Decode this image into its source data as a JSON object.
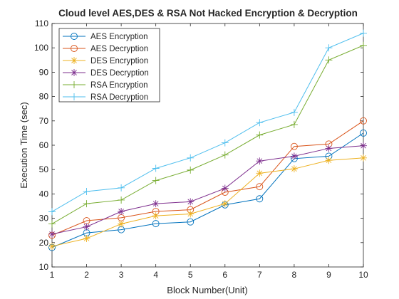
{
  "chart_data": {
    "type": "line",
    "title": "Cloud level AES,DES & RSA Not Hacked Encryption & Decryption",
    "xlabel": "Block Number(Unit)",
    "ylabel": "Execution Time (sec)",
    "xlim": [
      1,
      10
    ],
    "ylim": [
      10,
      110
    ],
    "xticks": [
      "1",
      "2",
      "3",
      "4",
      "5",
      "6",
      "7",
      "8",
      "9",
      "10"
    ],
    "yticks": [
      "10",
      "20",
      "30",
      "40",
      "50",
      "60",
      "70",
      "80",
      "90",
      "100",
      "110"
    ],
    "legend_position": "top-left",
    "x": [
      1,
      2,
      3,
      4,
      5,
      6,
      7,
      8,
      9,
      10
    ],
    "series": [
      {
        "name": "AES Encryption",
        "color": "#0072BD",
        "marker": "circle",
        "values": [
          18,
          24,
          25.3,
          27.8,
          28.5,
          35.5,
          38,
          54.5,
          55.5,
          65
        ]
      },
      {
        "name": "AES Decryption",
        "color": "#D95319",
        "marker": "circle",
        "values": [
          23,
          29,
          30.2,
          32.8,
          33.5,
          40.7,
          43,
          59.5,
          60.5,
          70
        ]
      },
      {
        "name": "DES Encryption",
        "color": "#EDB120",
        "marker": "asterisk",
        "values": [
          18.5,
          21.7,
          27.7,
          31,
          31.8,
          36,
          48.5,
          50.3,
          53.8,
          54.8
        ]
      },
      {
        "name": "DES Decryption",
        "color": "#7E2F8E",
        "marker": "asterisk",
        "values": [
          23.5,
          26.5,
          32.8,
          36,
          36.8,
          42.3,
          53.5,
          55.5,
          58.7,
          59.8
        ]
      },
      {
        "name": "RSA Encryption",
        "color": "#77AC30",
        "marker": "plus",
        "values": [
          27.7,
          36,
          37.5,
          45.5,
          49.8,
          56,
          64.2,
          68.5,
          95,
          101
        ]
      },
      {
        "name": "RSA Decryption",
        "color": "#4DBEEE",
        "marker": "plus",
        "values": [
          32.7,
          41,
          42.5,
          50.5,
          54.8,
          61,
          69.3,
          73.5,
          100,
          106
        ]
      }
    ]
  }
}
